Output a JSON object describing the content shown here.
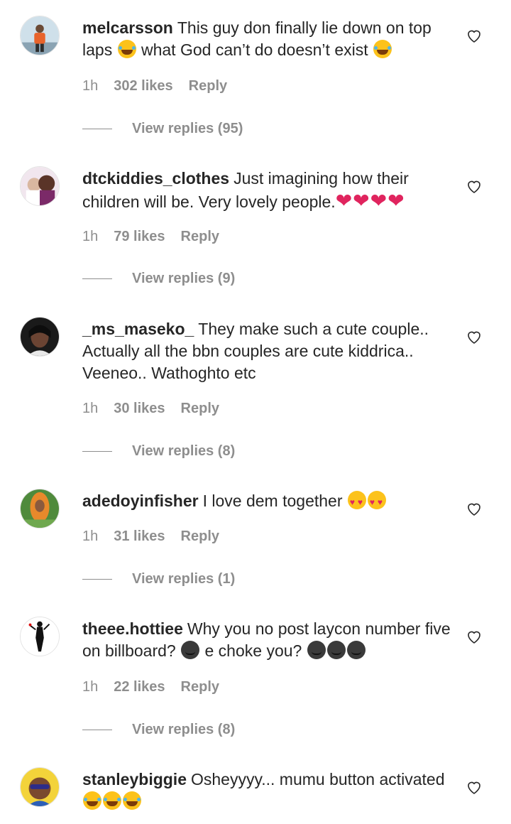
{
  "comments": [
    {
      "username": "melcarsson",
      "text_parts": [
        "This guy don finally lie down on top laps",
        "what God can’t do doesn’t exist"
      ],
      "time": "1h",
      "likes": "302 likes",
      "reply_label": "Reply",
      "view_replies": "View replies (95)"
    },
    {
      "username": "dtckiddies_clothes",
      "text_parts": [
        "Just imagining how their children will be. Very lovely people."
      ],
      "hearts": "❤❤❤❤",
      "time": "1h",
      "likes": "79 likes",
      "reply_label": "Reply",
      "view_replies": "View replies (9)"
    },
    {
      "username": "_ms_maseko_",
      "text_parts": [
        "They make such a cute couple.. Actually all the bbn couples are cute kiddrica.. Veeneo.. Wathoghto etc"
      ],
      "time": "1h",
      "likes": "30 likes",
      "reply_label": "Reply",
      "view_replies": "View replies (8)"
    },
    {
      "username": "adedoyinfisher",
      "text_parts": [
        "I love dem together"
      ],
      "time": "1h",
      "likes": "31 likes",
      "reply_label": "Reply",
      "view_replies": "View replies (1)"
    },
    {
      "username": "theee.hottiee",
      "text_parts": [
        "Why you no post laycon number five on billboard?",
        "e choke you?"
      ],
      "time": "1h",
      "likes": "22 likes",
      "reply_label": "Reply",
      "view_replies": "View replies (8)"
    },
    {
      "username": "stanleybiggie",
      "text_parts": [
        "Osheyyyy... mumu button activated"
      ]
    }
  ],
  "icons": {
    "like": "heart-outline-icon",
    "emoji_laugh": "face-with-tears-of-joy",
    "emoji_love": "smiling-face-with-heart-eyes",
    "emoji_dark": "dark-smirk-face"
  },
  "colors": {
    "text": "#262626",
    "meta": "#8e8e8e",
    "heart_red": "#e0245e"
  }
}
